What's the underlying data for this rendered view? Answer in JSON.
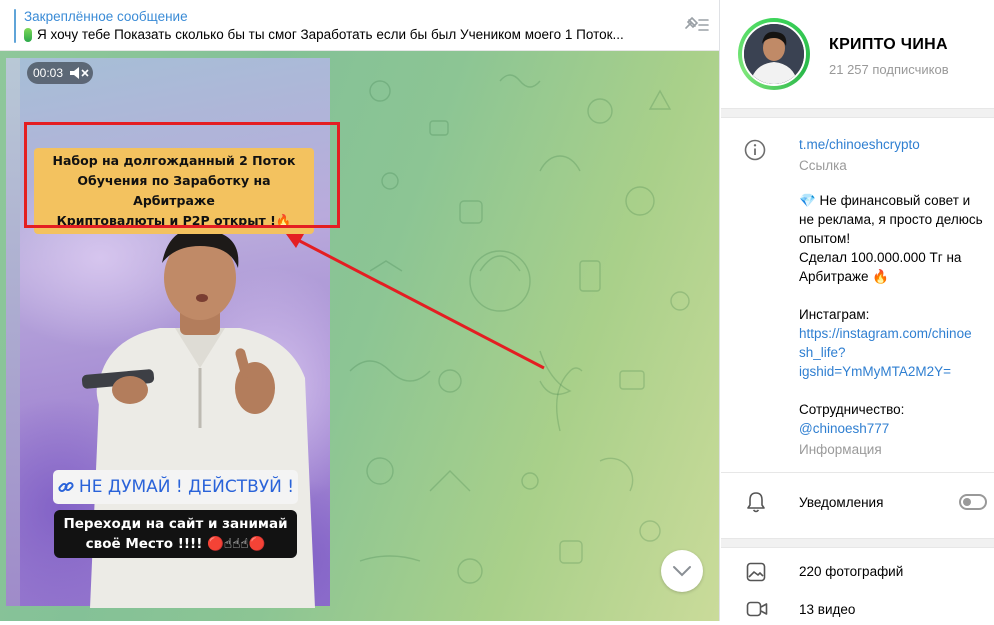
{
  "pinned": {
    "title": "Закреплённое сообщение",
    "text": "Я хочу тебе Показать сколько бы ты смог Заработать если бы был Учеником моего 1 Поток..."
  },
  "video": {
    "time": "00:03",
    "banner_lines": [
      "Набор на долгожданный 2 Поток",
      "Обучения по Заработку на Арбитраже",
      "Криптовалюты и P2P открыт !🔥"
    ],
    "cta": "НЕ ДУМАЙ ! ДЕЙСТВУЙ !",
    "sub_lines": [
      "Переходи на сайт и занимай",
      "своё Место !!!!"
    ],
    "sub_emoji": "🔴☝☝☝🔴"
  },
  "channel": {
    "name": "КРИПТО ЧИНА",
    "subscribers": "21 257 подписчиков",
    "link": "t.me/chinoeshcrypto",
    "link_label": "Ссылка",
    "desc_lines": [
      "💎 Не финансовый совет и",
      "не реклама, я просто делюсь",
      "опытом!",
      "Сделал 100.000.000 Тг на",
      "Арбитраже 🔥"
    ],
    "instagram_label": "Инстаграм:",
    "instagram_link_lines": [
      "https://instagram.com/chinoe",
      "sh_life?",
      "igshid=YmMyMTA2M2Y="
    ],
    "collab_label": "Сотрудничество:",
    "collab_handle": "@chinoesh777",
    "info_label": "Информация",
    "notifications_label": "Уведомления",
    "notifications_on": false,
    "photos": "220 фотографий",
    "videos": "13 видео"
  },
  "colors": {
    "accent": "#3a8bd6",
    "link": "#2f7fd1",
    "frame": "#e41e22",
    "avatar_ring": "#3cd45a"
  }
}
